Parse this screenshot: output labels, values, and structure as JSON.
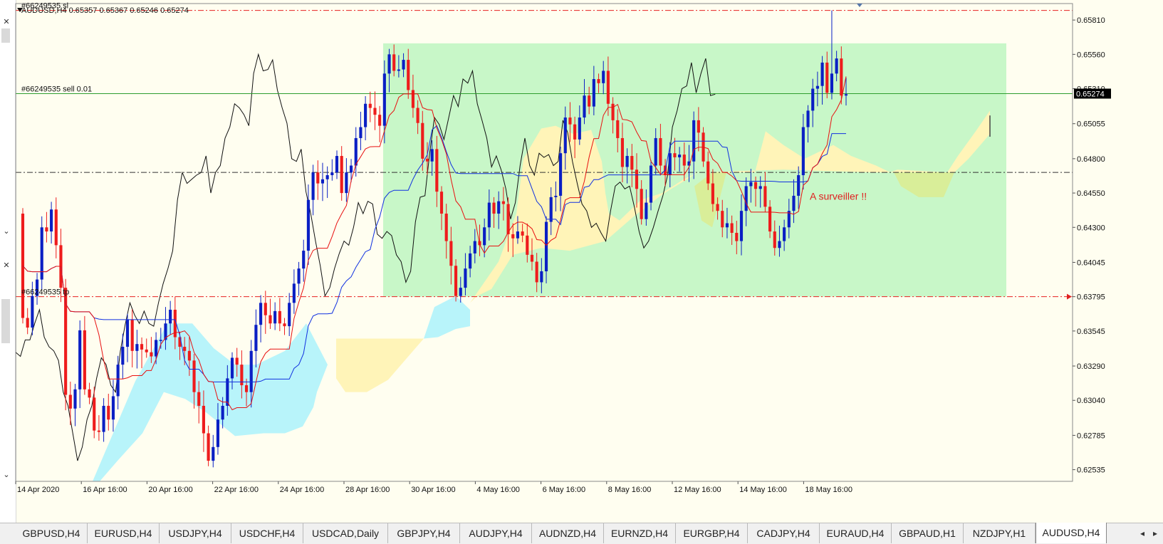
{
  "chart_data": {
    "type": "candlestick",
    "symbol": "AUDUSD",
    "timeframe": "H4",
    "header": "AUDUSD,H4  0.65357 0.65367 0.65246 0.65274",
    "ylim": [
      0.6245,
      0.6593
    ],
    "y_ticks": [
      "0.65810",
      "0.65560",
      "0.65310",
      "0.65055",
      "0.64800",
      "0.64550",
      "0.64300",
      "0.64045",
      "0.63795",
      "0.63545",
      "0.63290",
      "0.63040",
      "0.62785",
      "0.62535"
    ],
    "x_ticks": [
      "14 Apr 2020",
      "16 Apr 16:00",
      "20 Apr 16:00",
      "22 Apr 16:00",
      "24 Apr 16:00",
      "28 Apr 16:00",
      "30 Apr 16:00",
      "4 May 16:00",
      "6 May 16:00",
      "8 May 16:00",
      "12 May 16:00",
      "14 May 16:00",
      "18 May 16:00"
    ],
    "current_price": "0.65274",
    "levels": [
      {
        "label": "#66249535 sl",
        "price": 0.6588,
        "color": "#e82020",
        "style": "dash-dot"
      },
      {
        "label": "#66249535 sell 0.01",
        "price": 0.65274,
        "color": "#2e9e2e",
        "style": "solid"
      },
      {
        "label": "#66249535 tp",
        "price": 0.63795,
        "color": "#e82020",
        "style": "dash-dot"
      },
      {
        "label": "",
        "price": 0.647,
        "color": "#333333",
        "style": "dash-dot"
      }
    ],
    "annotation": "A surveiller !!",
    "rectangle": {
      "color": "#c8f7c8",
      "price_top": 0.6564,
      "price_bottom": 0.63795
    },
    "bull_color": "#0a1fc4",
    "bear_color": "#ee1c1c",
    "tenkan_color": "#e81010",
    "kijun_color": "#1030e0",
    "chikou_color": "#111111",
    "cloud_bull_color": "#fff4b8",
    "cloud_bear_color": "#b8f4fa"
  },
  "tabs": [
    "GBPUSD,H4",
    "EURUSD,H4",
    "USDJPY,H4",
    "USDCHF,H4",
    "USDCAD,Daily",
    "GBPJPY,H4",
    "AUDJPY,H4",
    "AUDNZD,H4",
    "EURNZD,H4",
    "EURGBP,H4",
    "CADJPY,H4",
    "EURAUD,H4",
    "GBPAUD,H1",
    "NZDJPY,H1",
    "AUDUSD,H4"
  ],
  "active_tab": "AUDUSD,H4"
}
